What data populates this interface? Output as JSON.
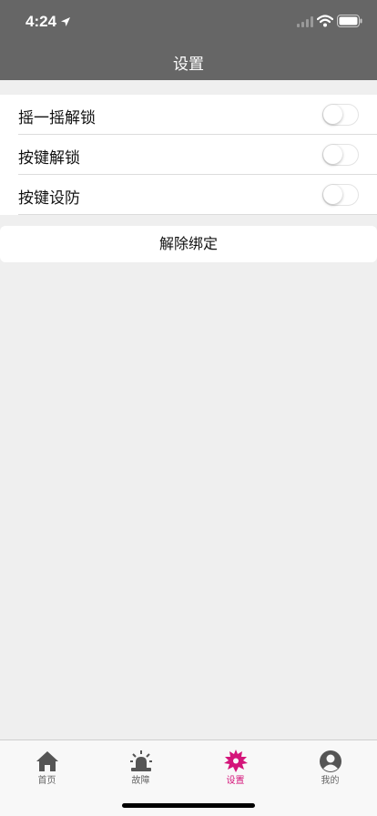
{
  "status_bar": {
    "time": "4:24"
  },
  "nav": {
    "title": "设置"
  },
  "settings": [
    {
      "label": "摇一摇解锁",
      "on": false
    },
    {
      "label": "按键解锁",
      "on": false
    },
    {
      "label": "按键设防",
      "on": false
    }
  ],
  "unbind_label": "解除绑定",
  "tabs": [
    {
      "label": "首页",
      "icon": "home-icon",
      "active": false
    },
    {
      "label": "故障",
      "icon": "alarm-icon",
      "active": false
    },
    {
      "label": "设置",
      "icon": "gear-icon",
      "active": true
    },
    {
      "label": "我的",
      "icon": "user-icon",
      "active": false
    }
  ],
  "colors": {
    "header": "#666666",
    "accent": "#d4157a",
    "background": "#efefef"
  }
}
